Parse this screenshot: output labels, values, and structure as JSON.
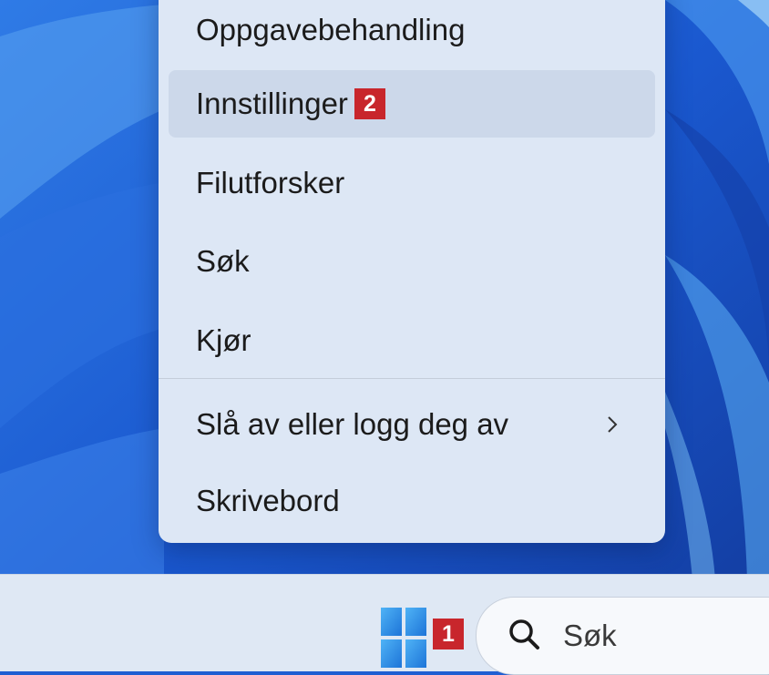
{
  "context_menu": {
    "items": [
      {
        "label": "Oppgavebehandling"
      },
      {
        "label": "Innstillinger",
        "badge": "2"
      },
      {
        "label": "Filutforsker"
      },
      {
        "label": "Søk"
      },
      {
        "label": "Kjør"
      },
      {
        "label": "Slå av eller logg deg av",
        "submenu_icon": "chevron-right-icon"
      },
      {
        "label": "Skrivebord"
      }
    ]
  },
  "taskbar": {
    "start_icon": "windows-logo-icon",
    "start_badge": "1",
    "search": {
      "icon": "search-icon",
      "placeholder": "Søk"
    }
  },
  "colors": {
    "badge": "#c8262c",
    "menu_background": "#dde7f5",
    "taskbar_background": "#dfe8f4",
    "wallpaper": "#1f5fd2"
  }
}
